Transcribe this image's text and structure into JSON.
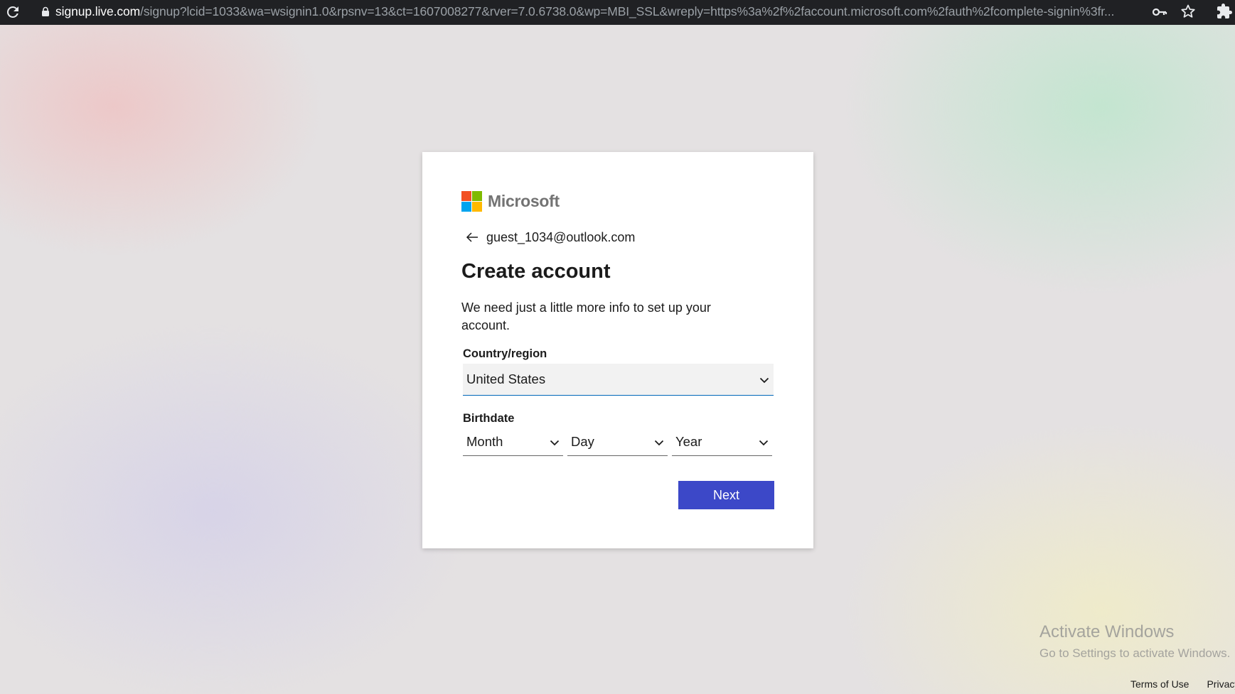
{
  "browser": {
    "url_host": "signup.live.com",
    "url_path": "/signup?lcid=1033&wa=wsignin1.0&rpsnv=13&ct=1607008277&rver=7.0.6738.0&wp=MBI_SSL&wreply=https%3a%2f%2faccount.microsoft.com%2fauth%2fcomplete-signin%3fr..."
  },
  "brand": {
    "name": "Microsoft",
    "colors": [
      "#f25022",
      "#7fba00",
      "#00a4ef",
      "#ffb900"
    ]
  },
  "identity": {
    "email": "guest_1034@outlook.com"
  },
  "form": {
    "title": "Create account",
    "description": "We need just a little more info to set up your account.",
    "country_label": "Country/region",
    "country_value": "United States",
    "birthdate_label": "Birthdate",
    "month_value": "Month",
    "day_value": "Day",
    "year_value": "Year",
    "next_label": "Next"
  },
  "watermark": {
    "line1": "Activate Windows",
    "line2": "Go to Settings to activate Windows."
  },
  "footer": {
    "terms": "Terms of Use",
    "privacy": "Privacy & cookies"
  },
  "colors": {
    "accent": "#3c48c8",
    "select_focus": "#0067b8"
  }
}
